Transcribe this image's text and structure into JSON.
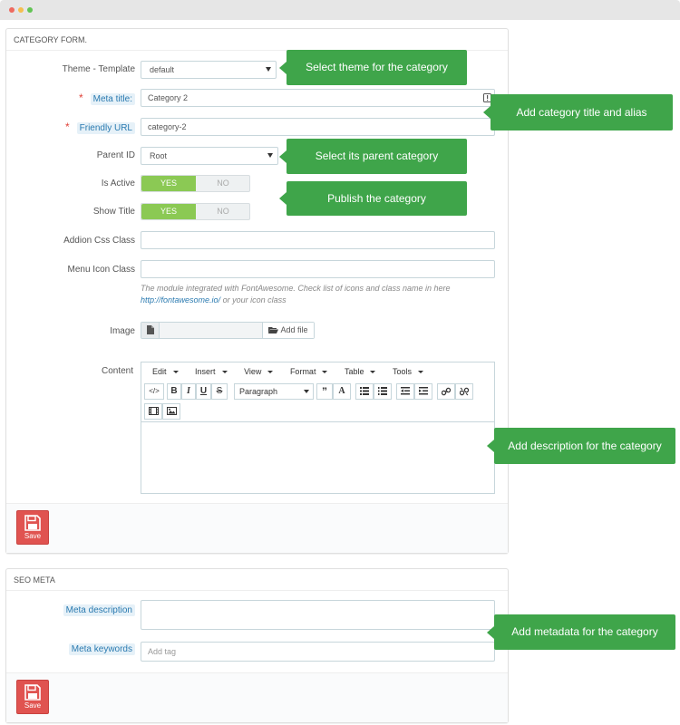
{
  "category_form": {
    "title": "CATEGORY FORM.",
    "theme_template_label": "Theme - Template",
    "theme_template_value": "default",
    "meta_title_label": "Meta title:",
    "meta_title_value": "Category 2",
    "friendly_url_label": "Friendly URL",
    "friendly_url_value": "category-2",
    "parent_id_label": "Parent ID",
    "parent_id_value": "Root",
    "is_active_label": "Is Active",
    "show_title_label": "Show Title",
    "yes_label": "YES",
    "no_label": "NO",
    "addion_css_label": "Addion Css Class",
    "menu_icon_label": "Menu Icon Class",
    "menu_icon_help_1": "The module integrated with FontAwesome. Check list of icons and class name in here",
    "menu_icon_help_link": "http://fontawesome.io/",
    "menu_icon_help_2": " or your icon class",
    "image_label": "Image",
    "add_file_label": "Add file",
    "content_label": "Content",
    "editor_menu": [
      "Edit",
      "Insert",
      "View",
      "Format",
      "Table",
      "Tools"
    ],
    "block_format": "Paragraph",
    "save_label": "Save"
  },
  "seo_meta": {
    "title": "SEO META",
    "meta_description_label": "Meta description",
    "meta_keywords_label": "Meta keywords",
    "meta_keywords_placeholder": "Add tag",
    "save_label": "Save"
  },
  "callouts": {
    "theme": "Select theme for the category",
    "title_alias": "Add category title and alias",
    "parent": "Select its parent category",
    "publish": "Publish the category",
    "description": "Add description for the category",
    "metadata": "Add metadata for the category"
  },
  "colors": {
    "callout": "#3fa54a",
    "switch_yes": "#8bc954",
    "save_button": "#e05350",
    "hint_label_bg": "#e6f1f8",
    "link": "#2a7ab0"
  }
}
